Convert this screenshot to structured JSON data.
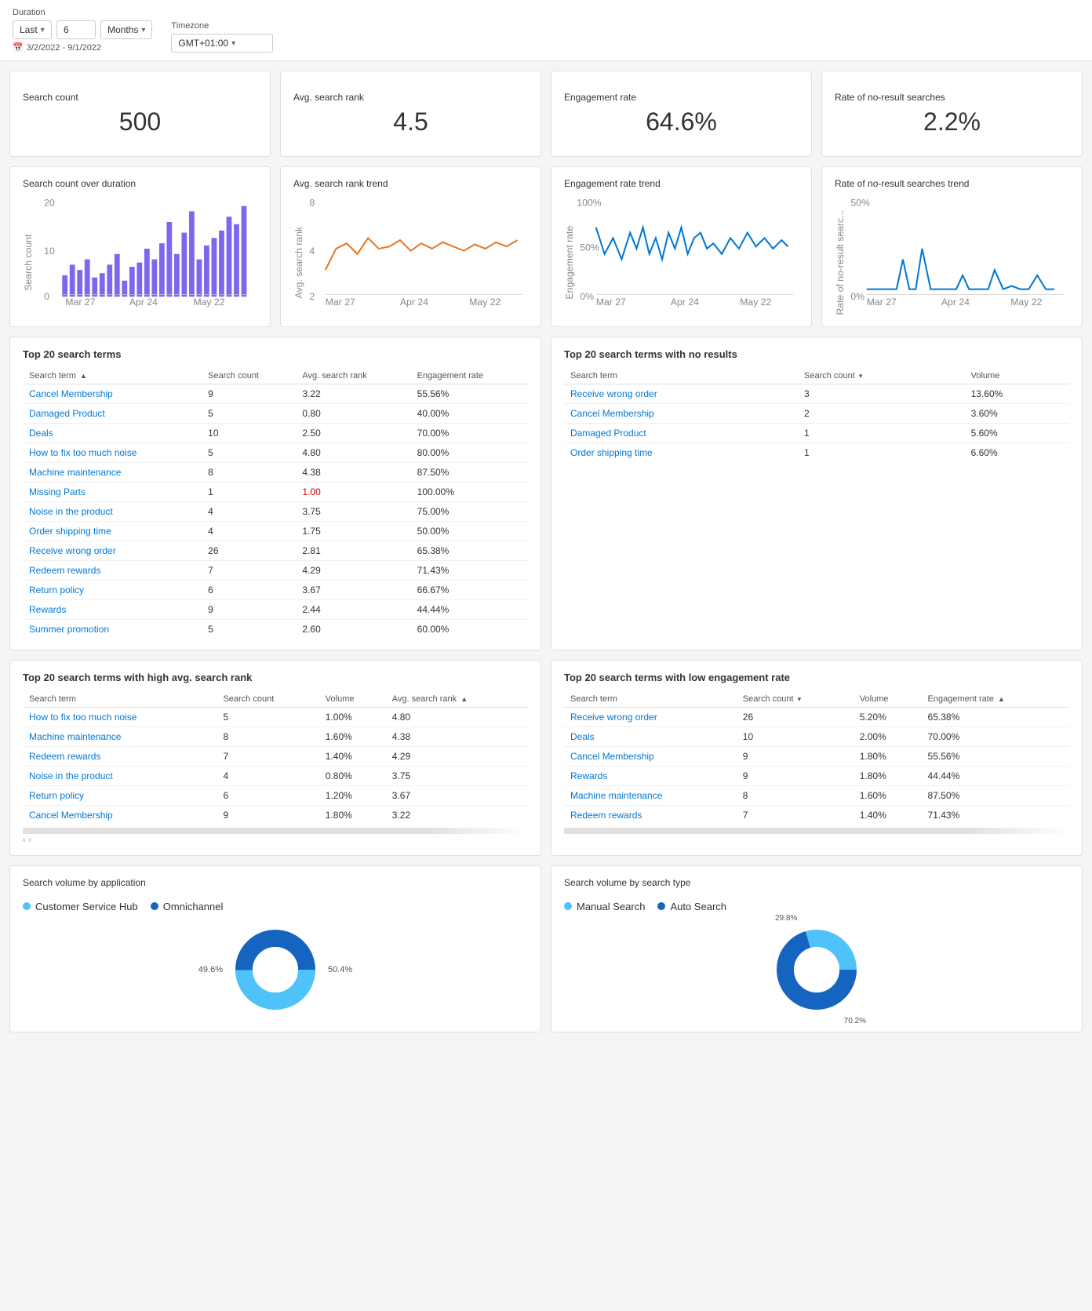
{
  "topbar": {
    "duration_label": "Duration",
    "last_label": "Last",
    "last_value": "6",
    "months_value": "Months",
    "timezone_label": "Timezone",
    "timezone_value": "GMT+01:00",
    "date_range_icon": "📅",
    "date_range": "3/2/2022 - 9/1/2022"
  },
  "metrics": [
    {
      "title": "Search count",
      "value": "500"
    },
    {
      "title": "Avg. search rank",
      "value": "4.5"
    },
    {
      "title": "Engagement rate",
      "value": "64.6%"
    },
    {
      "title": "Rate of no-result searches",
      "value": "2.2%"
    }
  ],
  "trend_charts": [
    {
      "title": "Search count over duration",
      "type": "bar",
      "color": "#7B68EE",
      "ylabel": "Search count",
      "xLabels": [
        "Mar 27",
        "Apr 24",
        "May 22"
      ],
      "yMax": 20
    },
    {
      "title": "Avg. search rank trend",
      "type": "line",
      "color": "#E87722",
      "ylabel": "Avg. search rank",
      "xLabels": [
        "Mar 27",
        "Apr 24",
        "May 22"
      ],
      "yMax": 8
    },
    {
      "title": "Engagement rate trend",
      "type": "line",
      "color": "#0078d4",
      "ylabel": "Engagement rate",
      "xLabels": [
        "Mar 27",
        "Apr 24",
        "May 22"
      ],
      "yMax": 100,
      "yTick": "50%"
    },
    {
      "title": "Rate of no-result searches trend",
      "type": "line",
      "color": "#0078d4",
      "ylabel": "Rate of no-result searc...",
      "xLabels": [
        "Mar 27",
        "Apr 24",
        "May 22"
      ],
      "yMax": 50,
      "yTick": "50%"
    }
  ],
  "top20_terms": {
    "title": "Top 20 search terms",
    "columns": [
      "Search term",
      "Search count",
      "Avg. search rank",
      "Engagement rate"
    ],
    "rows": [
      [
        "Cancel Membership",
        "9",
        "3.22",
        "55.56%"
      ],
      [
        "Damaged Product",
        "5",
        "0.80",
        "40.00%"
      ],
      [
        "Deals",
        "10",
        "2.50",
        "70.00%"
      ],
      [
        "How to fix too much noise",
        "5",
        "4.80",
        "80.00%"
      ],
      [
        "Machine maintenance",
        "8",
        "4.38",
        "87.50%"
      ],
      [
        "Missing Parts",
        "1",
        "1.00",
        "100.00%"
      ],
      [
        "Noise in the product",
        "4",
        "3.75",
        "75.00%"
      ],
      [
        "Order shipping time",
        "4",
        "1.75",
        "50.00%"
      ],
      [
        "Receive wrong order",
        "26",
        "2.81",
        "65.38%"
      ],
      [
        "Redeem rewards",
        "7",
        "4.29",
        "71.43%"
      ],
      [
        "Return policy",
        "6",
        "3.67",
        "66.67%"
      ],
      [
        "Rewards",
        "9",
        "2.44",
        "44.44%"
      ],
      [
        "Summer promotion",
        "5",
        "2.60",
        "60.00%"
      ]
    ]
  },
  "top20_no_results": {
    "title": "Top 20 search terms with no results",
    "columns": [
      "Search term",
      "Search count",
      "Volume"
    ],
    "rows": [
      [
        "Receive wrong order",
        "3",
        "13.60%"
      ],
      [
        "Cancel Membership",
        "2",
        "3.60%"
      ],
      [
        "Damaged Product",
        "1",
        "5.60%"
      ],
      [
        "Order shipping time",
        "1",
        "6.60%"
      ]
    ]
  },
  "top20_high_rank": {
    "title": "Top 20 search terms with high avg. search rank",
    "columns": [
      "Search term",
      "Search count",
      "Volume",
      "Avg. search rank"
    ],
    "sort_col": "Avg. search rank",
    "rows": [
      [
        "How to fix too much noise",
        "5",
        "1.00%",
        "4.80"
      ],
      [
        "Machine maintenance",
        "8",
        "1.60%",
        "4.38"
      ],
      [
        "Redeem rewards",
        "7",
        "1.40%",
        "4.29"
      ],
      [
        "Noise in the product",
        "4",
        "0.80%",
        "3.75"
      ],
      [
        "Return policy",
        "6",
        "1.20%",
        "3.67"
      ],
      [
        "Cancel Membership",
        "9",
        "1.80%",
        "3.22"
      ]
    ]
  },
  "top20_low_engagement": {
    "title": "Top 20 search terms with low engagement rate",
    "columns": [
      "Search term",
      "Search count",
      "Volume",
      "Engagement rate"
    ],
    "sort_col": "Engagement rate",
    "rows": [
      [
        "Receive wrong order",
        "26",
        "5.20%",
        "65.38%"
      ],
      [
        "Deals",
        "10",
        "2.00%",
        "70.00%"
      ],
      [
        "Cancel Membership",
        "9",
        "1.80%",
        "55.56%"
      ],
      [
        "Rewards",
        "9",
        "1.80%",
        "44.44%"
      ],
      [
        "Machine maintenance",
        "8",
        "1.60%",
        "87.50%"
      ],
      [
        "Redeem rewards",
        "7",
        "1.40%",
        "71.43%"
      ]
    ]
  },
  "donut_application": {
    "title": "Search volume by application",
    "segments": [
      {
        "label": "Customer Service Hub",
        "color": "#4FC3F7",
        "value": 49.6,
        "percent": "49.6%"
      },
      {
        "label": "Omnichannel",
        "color": "#1565C0",
        "value": 50.4,
        "percent": "50.4%"
      }
    ],
    "left_label": "49.6%",
    "right_label": "50.4%"
  },
  "donut_search_type": {
    "title": "Search volume by search type",
    "segments": [
      {
        "label": "Manual Search",
        "color": "#4FC3F7",
        "value": 29.8,
        "percent": "29.8%"
      },
      {
        "label": "Auto Search",
        "color": "#1565C0",
        "value": 70.2,
        "percent": "70.2%"
      }
    ],
    "top_label": "29.8%",
    "bottom_label": "70.2%"
  }
}
